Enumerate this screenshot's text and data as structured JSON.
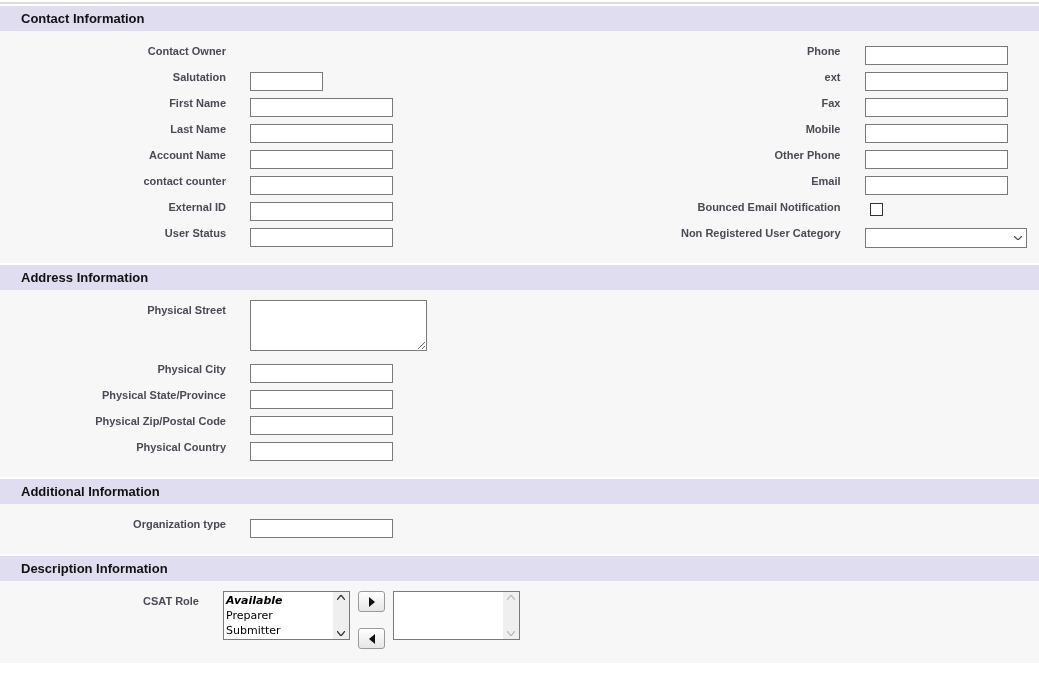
{
  "sections": [
    {
      "title": "Contact Information",
      "rows": [
        {
          "left": {
            "label": "Contact Owner",
            "kind": "none"
          },
          "right": {
            "label": "Phone",
            "kind": "text"
          }
        },
        {
          "left": {
            "label": "Salutation",
            "kind": "short_text"
          },
          "right": {
            "label": "ext",
            "kind": "text"
          }
        },
        {
          "left": {
            "label": "First Name",
            "kind": "text"
          },
          "right": {
            "label": "Fax",
            "kind": "text"
          }
        },
        {
          "left": {
            "label": "Last Name",
            "kind": "text"
          },
          "right": {
            "label": "Mobile",
            "kind": "text"
          }
        },
        {
          "left": {
            "label": "Account Name",
            "kind": "text"
          },
          "right": {
            "label": "Other Phone",
            "kind": "text"
          }
        },
        {
          "left": {
            "label": "contact counter",
            "kind": "text"
          },
          "right": {
            "label": "Email",
            "kind": "text"
          }
        },
        {
          "left": {
            "label": "External ID",
            "kind": "text"
          },
          "right": {
            "label": "Bounced Email Notification",
            "kind": "checkbox",
            "checked": false
          }
        },
        {
          "left": {
            "label": "User Status",
            "kind": "text"
          },
          "right": {
            "label": "Non Registered User Category",
            "kind": "select"
          }
        }
      ]
    },
    {
      "title": "Address Information",
      "rows": [
        {
          "left": {
            "label": "Physical Street",
            "kind": "textarea"
          }
        },
        {
          "left": {
            "label": "Physical City",
            "kind": "text"
          }
        },
        {
          "left": {
            "label": "Physical State/Province",
            "kind": "text"
          }
        },
        {
          "left": {
            "label": "Physical Zip/Postal Code",
            "kind": "text"
          }
        },
        {
          "left": {
            "label": "Physical Country",
            "kind": "text"
          }
        }
      ]
    },
    {
      "title": "Additional Information",
      "rows": [
        {
          "left": {
            "label": "Organization type",
            "kind": "text"
          }
        }
      ]
    },
    {
      "title": "Description Information",
      "rows": [
        {
          "left": {
            "label": "CSAT Role",
            "kind": "multiselect",
            "available_heading": "Available",
            "options": [
              "Preparer",
              "Submitter"
            ]
          }
        }
      ]
    }
  ]
}
